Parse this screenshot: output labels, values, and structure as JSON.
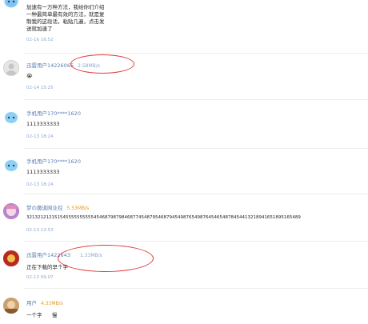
{
  "comments": [
    {
      "lines": [
        "加速有一万种方法，我给你们介绍",
        "一种最简单最有效的方法，就是复",
        "制我的这段话，粘贴几遍，点击发",
        "送就加速了"
      ],
      "time": "02-16 16:52"
    },
    {
      "user": "迅雷用户14226065",
      "speed": "2.58MB/s",
      "text": "😭",
      "time": "02-14 15:25"
    },
    {
      "user": "手机用户170****1620",
      "text": "1113333333",
      "time": "02-13 18:24"
    },
    {
      "user": "手机用户170****1620",
      "text": "1113333333",
      "time": "02-13 18:24"
    },
    {
      "user": "梦の魔道网业控",
      "speed": "5.53MB/s",
      "text": "32132121215154555555555545468798798468774548795468794549876549876454654878454413218941651895165489",
      "time": "02-13 12:53"
    },
    {
      "user": "迅雷用户1422643",
      "speed": "1.33MB/s",
      "text": "正在下载的早个字",
      "time": "02-13 09:07"
    },
    {
      "user": "用户",
      "speed": "4.33MB/s",
      "text": "一个字      慢"
    }
  ],
  "colors": {
    "username": "#5a7fb0",
    "speed_orange": "#e59a1c",
    "speed_blue": "#8aa7cf",
    "annotation": "#e03a3a"
  }
}
